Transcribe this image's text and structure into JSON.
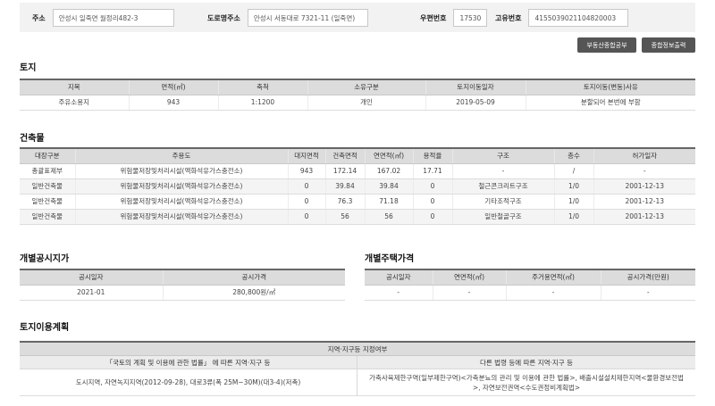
{
  "address": {
    "addr_label": "주소",
    "addr_value": "안성시 일죽면 월정리482-3",
    "road_label": "도로명주소",
    "road_value": "안성시 서동대로 7321-11 (일죽면)",
    "zip_label": "우편번호",
    "zip_value": "17530",
    "uid_label": "고유번호",
    "uid_value": "4155039021104820003"
  },
  "buttons": {
    "realestate": "부동산종합공부",
    "print": "종합정보출력"
  },
  "land": {
    "title": "토지",
    "headers": [
      "지목",
      "면적(㎡)",
      "축척",
      "소유구분",
      "토지이동일자",
      "토지이동(변동)사유"
    ],
    "rows": [
      [
        "주유소용지",
        "943",
        "1:1200",
        "개인",
        "2019-05-09",
        "분할되어 본번에 부함"
      ]
    ]
  },
  "building": {
    "title": "건축물",
    "headers": [
      "대장구분",
      "주용도",
      "대지면적",
      "건축면적",
      "연면적(㎡)",
      "용적율",
      "구조",
      "층수",
      "허가일자"
    ],
    "rows": [
      [
        "총괄표제부",
        "위험물저장및처리시설(액화석유가스충전소)",
        "943",
        "172.14",
        "167.02",
        "17.71",
        "-",
        "/",
        "-"
      ],
      [
        "일반건축물",
        "위험물저장및처리시설(액화석유가스충전소)",
        "0",
        "39.84",
        "39.84",
        "0",
        "철근콘크리트구조",
        "1/0",
        "2001-12-13"
      ],
      [
        "일반건축물",
        "위험물저장및처리시설(액화석유가스충전소)",
        "0",
        "76.3",
        "71.18",
        "0",
        "기타조적구조",
        "1/0",
        "2001-12-13"
      ],
      [
        "일반건축물",
        "위험물저장및처리시설(액화석유가스충전소)",
        "0",
        "56",
        "56",
        "0",
        "일반철골구조",
        "1/0",
        "2001-12-13"
      ]
    ]
  },
  "land_price": {
    "title": "개별공시지가",
    "headers": [
      "공시일자",
      "공시가격"
    ],
    "rows": [
      [
        "2021-01",
        "280,800원/㎡"
      ]
    ]
  },
  "house_price": {
    "title": "개별주택가격",
    "headers": [
      "공시일자",
      "연면적(㎡)",
      "주거용면적(㎡)",
      "공시가격(만원)"
    ],
    "rows": [
      [
        "-",
        "-",
        "-",
        "-"
      ]
    ]
  },
  "land_use": {
    "title": "토지이용계획",
    "header": "지역·지구등 지정여부",
    "left_header": "「국토의 계획 및 이용에 관한 법률」 에 따른 지역·지구 등",
    "right_header": "다른 법령 등에 따른 지역·지구 등",
    "left_value": "도시지역, 자연녹지지역(2012-09-28), 대로3류(폭 25M~30M)(대3-4)(저촉)",
    "right_value": "가축사육제한구역(일부제한구역)<가축분뇨의 관리 및 이용에 관한 법률>, 배출시설설치제한지역<물환경보전법>, 자연보전권역<수도권정비계획법>"
  }
}
